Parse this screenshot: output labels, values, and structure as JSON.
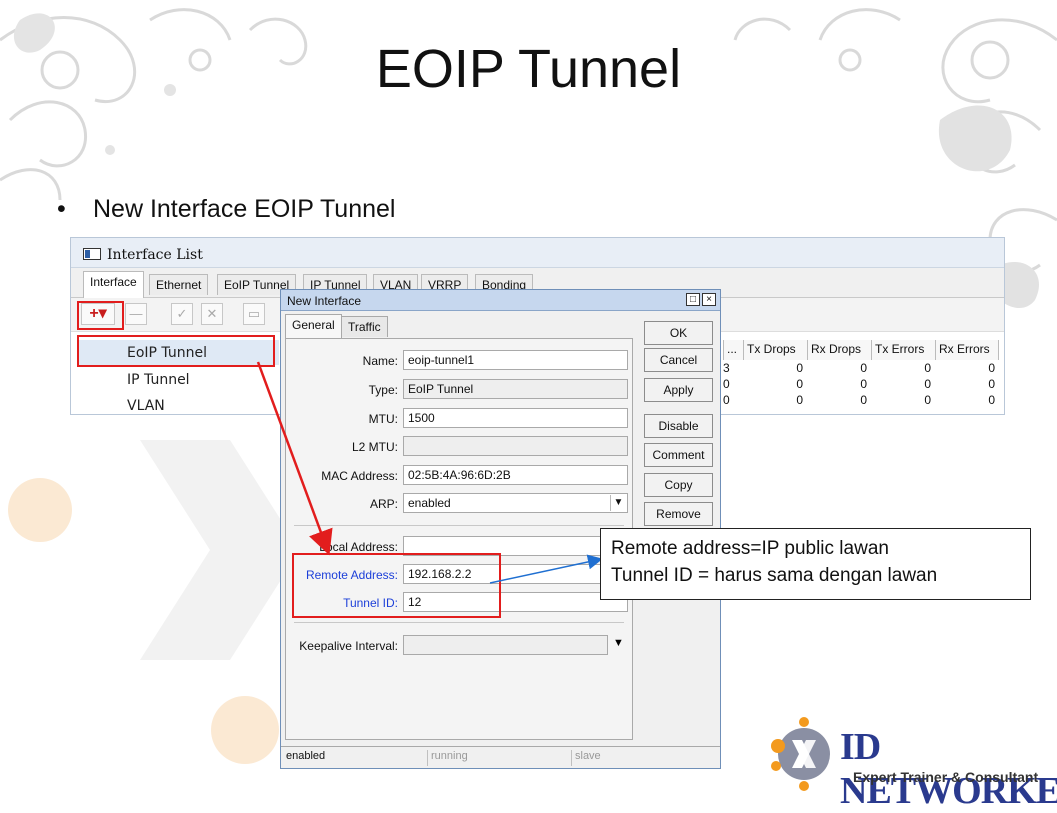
{
  "slide": {
    "title": "EOIP Tunnel",
    "bullet_marker": "•",
    "bullet": "New Interface EOIP Tunnel"
  },
  "interface_list": {
    "title": "Interface List",
    "tabs": [
      "Interface",
      "Ethernet",
      "EoIP Tunnel",
      "IP Tunnel",
      "VLAN",
      "VRRP",
      "Bonding"
    ],
    "add_label": "+▾",
    "rows": [
      "EoIP Tunnel",
      "IP Tunnel",
      "VLAN"
    ],
    "columns": [
      "...",
      "Tx Drops",
      "Rx Drops",
      "Tx Errors",
      "Rx Errors"
    ],
    "data_rows": [
      [
        "3",
        "0",
        "0",
        "0",
        "0"
      ],
      [
        "0",
        "0",
        "0",
        "0",
        "0"
      ],
      [
        "0",
        "0",
        "0",
        "0",
        "0"
      ]
    ]
  },
  "dialog": {
    "title": "New Interface",
    "controls": [
      "□",
      "×"
    ],
    "tabs": [
      "General",
      "Traffic"
    ],
    "fields": {
      "name_label": "Name:",
      "name_value": "eoip-tunnel1",
      "type_label": "Type:",
      "type_value": "EoIP Tunnel",
      "mtu_label": "MTU:",
      "mtu_value": "1500",
      "l2mtu_label": "L2 MTU:",
      "l2mtu_value": "",
      "mac_label": "MAC Address:",
      "mac_value": "02:5B:4A:96:6D:2B",
      "arp_label": "ARP:",
      "arp_value": "enabled",
      "local_label": "Local Address:",
      "local_value": "",
      "remote_label": "Remote Address:",
      "remote_value": "192.168.2.2",
      "tunnel_label": "Tunnel ID:",
      "tunnel_value": "12",
      "keepalive_label": "Keepalive Interval:",
      "keepalive_value": ""
    },
    "buttons": [
      "OK",
      "Cancel",
      "Apply",
      "Disable",
      "Comment",
      "Copy",
      "Remove"
    ],
    "status": [
      "enabled",
      "running",
      "slave"
    ]
  },
  "callout": {
    "line1": "Remote address=IP public lawan",
    "line2": "Tunnel ID = harus sama dengan lawan"
  },
  "logo": {
    "word": "ID NETWORKERS",
    "tagline": "Expert Trainer & Consultant",
    "colors": {
      "orange": "#f39a1e",
      "blue": "#2a3a8e"
    }
  },
  "colors": {
    "annotation_red": "#e21d1d",
    "arrow_blue": "#1f6fd1",
    "label_blue": "#1c3fd9"
  }
}
